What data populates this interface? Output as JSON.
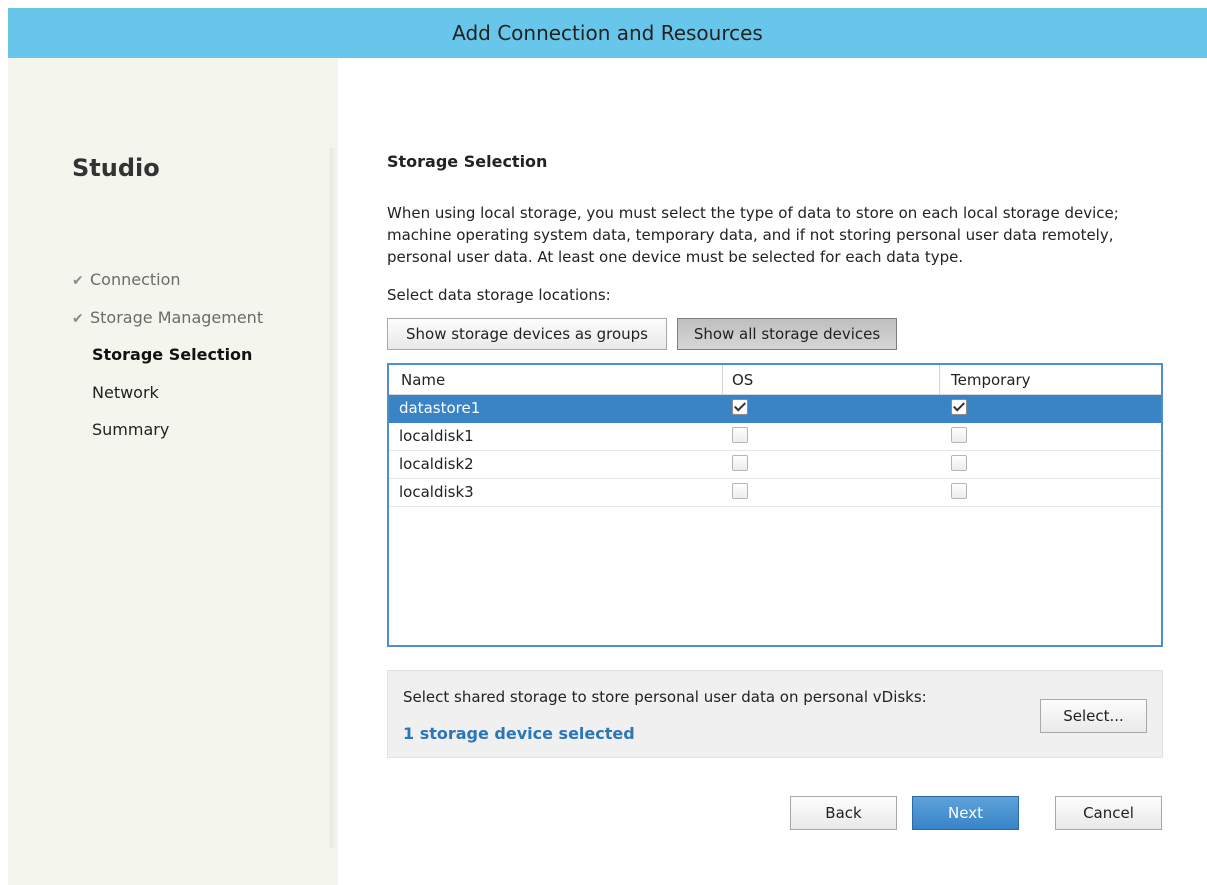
{
  "window": {
    "title": "Add Connection and Resources"
  },
  "sidebar": {
    "app_title": "Studio",
    "steps": [
      {
        "label": "Connection",
        "state": "done"
      },
      {
        "label": "Storage Management",
        "state": "done"
      },
      {
        "label": "Storage Selection",
        "state": "current"
      },
      {
        "label": "Network",
        "state": "pending"
      },
      {
        "label": "Summary",
        "state": "pending"
      }
    ],
    "check_glyph": "✔"
  },
  "main": {
    "heading": "Storage Selection",
    "description": "When using local storage, you must select the type of data to store on each local storage device; machine operating system data, temporary data, and if not storing personal user data remotely, personal user data. At least one device must be selected for each data type.",
    "select_label": "Select data storage locations:",
    "view_buttons": {
      "groups": "Show storage devices as groups",
      "all": "Show all storage devices"
    },
    "table": {
      "columns": [
        "Name",
        "OS",
        "Temporary"
      ],
      "rows": [
        {
          "name": "datastore1",
          "os": true,
          "temporary": true,
          "selected": true
        },
        {
          "name": "localdisk1",
          "os": false,
          "temporary": false,
          "selected": false
        },
        {
          "name": "localdisk2",
          "os": false,
          "temporary": false,
          "selected": false
        },
        {
          "name": "localdisk3",
          "os": false,
          "temporary": false,
          "selected": false
        }
      ]
    },
    "shared_storage": {
      "label": "Select shared storage to store personal user data on personal vDisks:",
      "status": "1 storage device selected",
      "select_button": "Select..."
    },
    "footer": {
      "back": "Back",
      "next": "Next",
      "cancel": "Cancel"
    }
  },
  "colors": {
    "titlebar": "#69c6eb",
    "selection": "#3a84c6",
    "link": "#2a76bd",
    "primary_button": "#3784c8"
  }
}
